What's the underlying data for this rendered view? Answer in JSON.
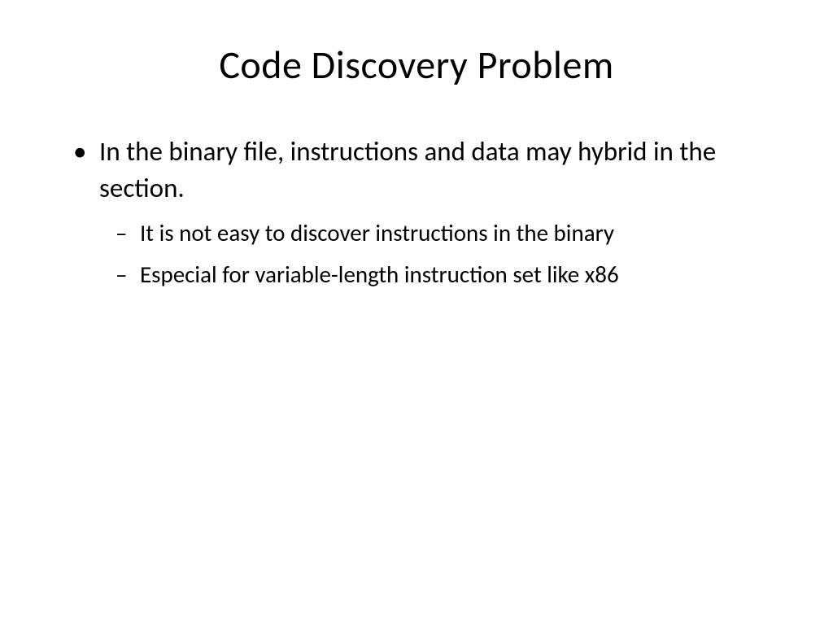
{
  "slide": {
    "title": "Code Discovery Problem",
    "bullets": {
      "main": "In the binary file, instructions and data may hybrid in the section.",
      "sub1": "It is not easy to discover instructions in the binary",
      "sub2": "Especial for variable-length instruction set like x86"
    }
  }
}
